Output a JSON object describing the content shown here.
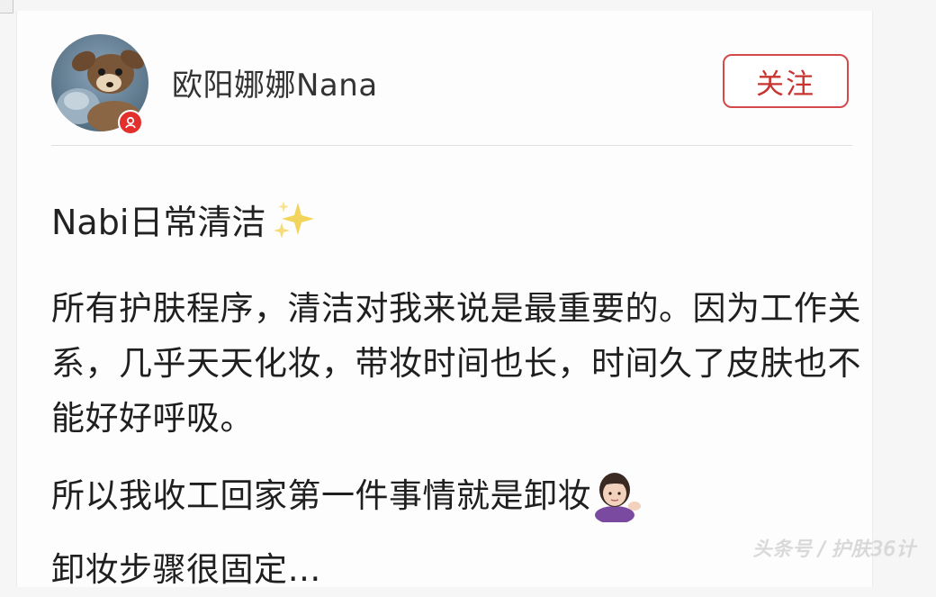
{
  "post": {
    "author": {
      "name": "欧阳娜娜Nana",
      "verified_color": "#e3302c"
    },
    "follow_label": "关注",
    "title": "Nabi日常清洁",
    "title_emoji": "sparkles-icon",
    "paragraphs": [
      "所有护肤程序，清洁对我来说是最重要的。因为工作关系，几乎天天化妆，带妆时间也长，时间久了皮肤也不能好好呼吸。",
      "所以我收工回家第一件事情就是卸妆",
      "卸妆步骤很固定…"
    ],
    "paragraph_2_emoji": "person-tipping-hand-icon"
  },
  "watermark": "头条号 / 护肤36计",
  "colors": {
    "accent": "#d44a4a",
    "text": "#1f1f1f",
    "background": "#fdfdfd"
  }
}
